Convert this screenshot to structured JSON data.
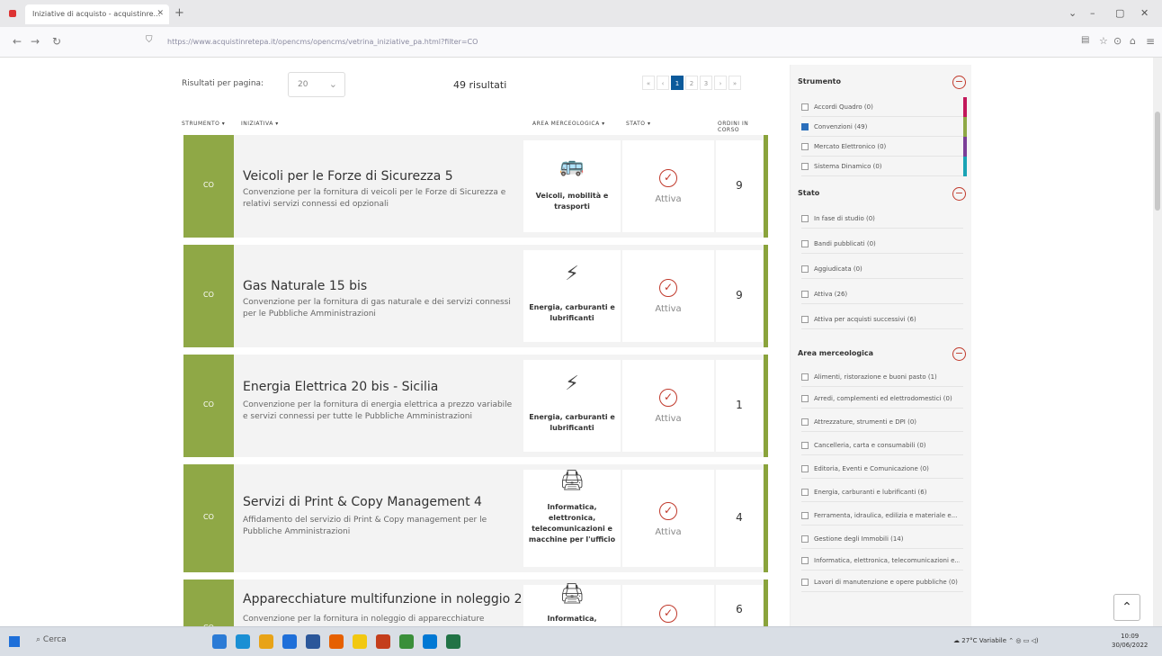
{
  "browser": {
    "tab_title": "Iniziative di acquisto - acquistinre…",
    "url_domain": "acquistinretepa.it",
    "url_full": "https://www.acquistinretepa.it/opencms/opencms/vetrina_iniziative_pa.html?filter=CO"
  },
  "toolbar": {
    "rpp_label": "Risultati per pagina:",
    "rpp_value": "20",
    "results": "49 risultati",
    "pages": [
      "«",
      "‹",
      "1",
      "2",
      "3",
      "›",
      "»"
    ]
  },
  "columns": {
    "strumento": "STRUMENTO ▾",
    "iniziativa": "INIZIATIVA ▾",
    "area": "AREA MERCEOLOGICA ▾",
    "stato": "STATO ▾",
    "ordini": "ORDINI IN CORSO"
  },
  "cards": [
    {
      "badge": "CO",
      "title": "Veicoli per le Forze di Sicurezza 5",
      "desc": "Convenzione per la fornitura di veicoli per le Forze di Sicurezza e relativi servizi connessi ed opzionali",
      "area": "Veicoli, mobilità e trasporti",
      "stato": "Attiva",
      "ordini": "9"
    },
    {
      "badge": "CO",
      "title": "Gas Naturale 15 bis",
      "desc": "Convenzione per la fornitura di gas naturale e dei servizi connessi per le Pubbliche Amministrazioni",
      "area": "Energia, carburanti e lubrificanti",
      "stato": "Attiva",
      "ordini": "9"
    },
    {
      "badge": "CO",
      "title": "Energia Elettrica 20 bis - Sicilia",
      "desc": "Convenzione per la fornitura di energia elettrica a prezzo variabile e servizi connessi per tutte le Pubbliche Amministrazioni",
      "area": "Energia, carburanti e lubrificanti",
      "stato": "Attiva",
      "ordini": "1"
    },
    {
      "badge": "CO",
      "title": "Servizi di Print & Copy Management 4",
      "desc": "Affidamento del servizio di Print & Copy management per le Pubbliche Amministrazioni",
      "area": "Informatica, elettronica, telecomunicazioni e macchine per l'ufficio",
      "stato": "Attiva",
      "ordini": "4"
    },
    {
      "badge": "CO",
      "title": "Apparecchiature multifunzione in noleggio 2",
      "desc": "Convenzione per la fornitura in noleggio di apparecchiature",
      "area": "Informatica, elettronica",
      "stato": "Attiva",
      "ordini": "6"
    }
  ],
  "sidebar": {
    "strumento": {
      "title": "Strumento",
      "toggle": "−",
      "options": [
        {
          "label": "Accordi Quadro (0)",
          "checked": false,
          "color": "#c2185b"
        },
        {
          "label": "Convenzioni (49)",
          "checked": true,
          "color": "#8fa846"
        },
        {
          "label": "Mercato Elettronico (0)",
          "checked": false,
          "color": "#7b3f98"
        },
        {
          "label": "Sistema Dinamico (0)",
          "checked": false,
          "color": "#1aa3b5"
        }
      ]
    },
    "stato": {
      "title": "Stato",
      "toggle": "−",
      "options": [
        {
          "label": "In fase di studio (0)",
          "checked": false
        },
        {
          "label": "Bandi pubblicati (0)",
          "checked": false
        },
        {
          "label": "Aggiudicata (0)",
          "checked": false
        },
        {
          "label": "Attiva (26)",
          "checked": false
        },
        {
          "label": "Attiva per acquisti successivi (6)",
          "checked": false
        }
      ]
    },
    "area": {
      "title": "Area merceologica",
      "toggle": "−",
      "options": [
        {
          "label": "Alimenti, ristorazione e buoni pasto (1)",
          "checked": false
        },
        {
          "label": "Arredi, complementi ed elettrodomestici (0)",
          "checked": false
        },
        {
          "label": "Attrezzature, strumenti e DPI (0)",
          "checked": false
        },
        {
          "label": "Cancelleria, carta e consumabili (0)",
          "checked": false
        },
        {
          "label": "Editoria, Eventi e Comunicazione (0)",
          "checked": false
        },
        {
          "label": "Energia, carburanti e lubrificanti (6)",
          "checked": false
        },
        {
          "label": "Ferramenta, idraulica, edilizia e materiale e... (0)",
          "checked": false
        },
        {
          "label": "Gestione degli Immobili (14)",
          "checked": false
        },
        {
          "label": "Informatica, elettronica, telecomunicazioni e... (20)",
          "checked": false
        },
        {
          "label": "Lavori di manutenzione e opere pubbliche (0)",
          "checked": false
        }
      ]
    }
  },
  "taskbar": {
    "search": "Cerca",
    "weather": "27°C Variabile",
    "time": "10:09",
    "date": "30/06/2022"
  }
}
